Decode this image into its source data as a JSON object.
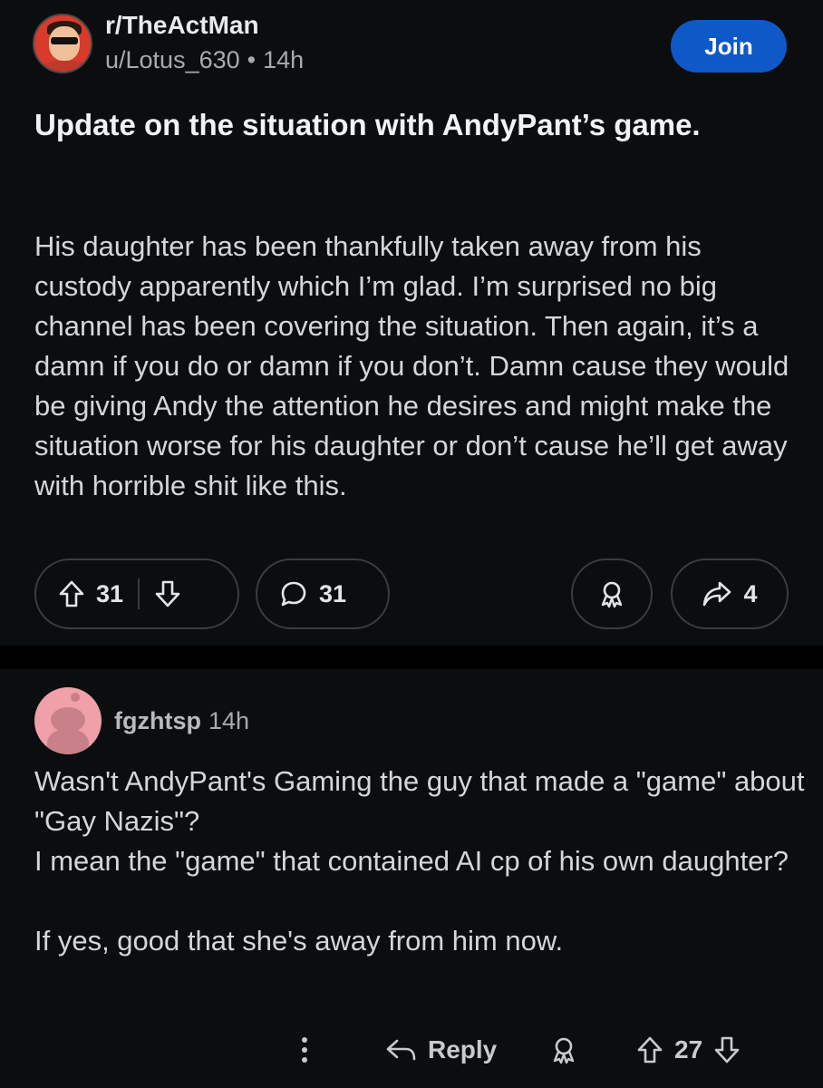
{
  "post": {
    "subreddit": "r/TheActMan",
    "author": "u/Lotus_630",
    "separator": "•",
    "time": "14h",
    "join_label": "Join",
    "title": "Update on the situation with AndyPant’s game.",
    "body": "His daughter has been thankfully taken away from his custody apparently which I’m glad. I’m surprised no big channel has been covering the situation. Then again, it’s a damn if you do or damn if you don’t. Damn cause they would be giving Andy the attention he desires and might make the situation worse for his daughter or don’t cause he’ll get away with horrible shit like this.",
    "upvotes": "31",
    "comments": "31",
    "shares": "4"
  },
  "comment": {
    "username": "fgzhtsp",
    "time": "14h",
    "lines": [
      "Wasn't AndyPant's Gaming the guy that made a \"game\" about \"Gay Nazis\"?",
      "I mean the \"game\" that contained AI cp of his own daughter?"
    ],
    "final_line": "If yes, good that she's away from him now.",
    "reply_label": "Reply",
    "upvotes": "27"
  },
  "icons": {
    "avatar": "user-avatar-icon",
    "upvote": "arrow-up-icon",
    "downvote": "arrow-down-icon",
    "comment": "comment-bubble-icon",
    "award": "award-icon",
    "share": "share-arrow-icon",
    "more": "more-vertical-icon",
    "reply": "reply-arrow-icon"
  },
  "colors": {
    "background": "#0b0d0e",
    "join_button": "#0f58c8",
    "text_primary": "#f0f2f4",
    "text_secondary": "#a8abae"
  }
}
